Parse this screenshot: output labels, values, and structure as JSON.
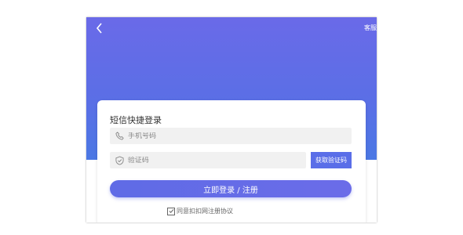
{
  "header": {
    "back_icon": "chevron-left-icon",
    "top_right_text": "客服"
  },
  "card": {
    "title": "短信快捷登录",
    "phone": {
      "placeholder": "手机号码",
      "icon": "phone-icon"
    },
    "code": {
      "placeholder": "验证码",
      "icon": "shield-icon"
    },
    "get_code_label": "获取验证码",
    "login_label": "立即登录 / 注册",
    "agreement_text": "同意扣扣网注册协议"
  },
  "colors": {
    "hero_top": "#6a6ae8",
    "hero_bottom": "#4b78e4",
    "accent": "#5a6ee8",
    "field_bg": "#f1f1f1"
  }
}
